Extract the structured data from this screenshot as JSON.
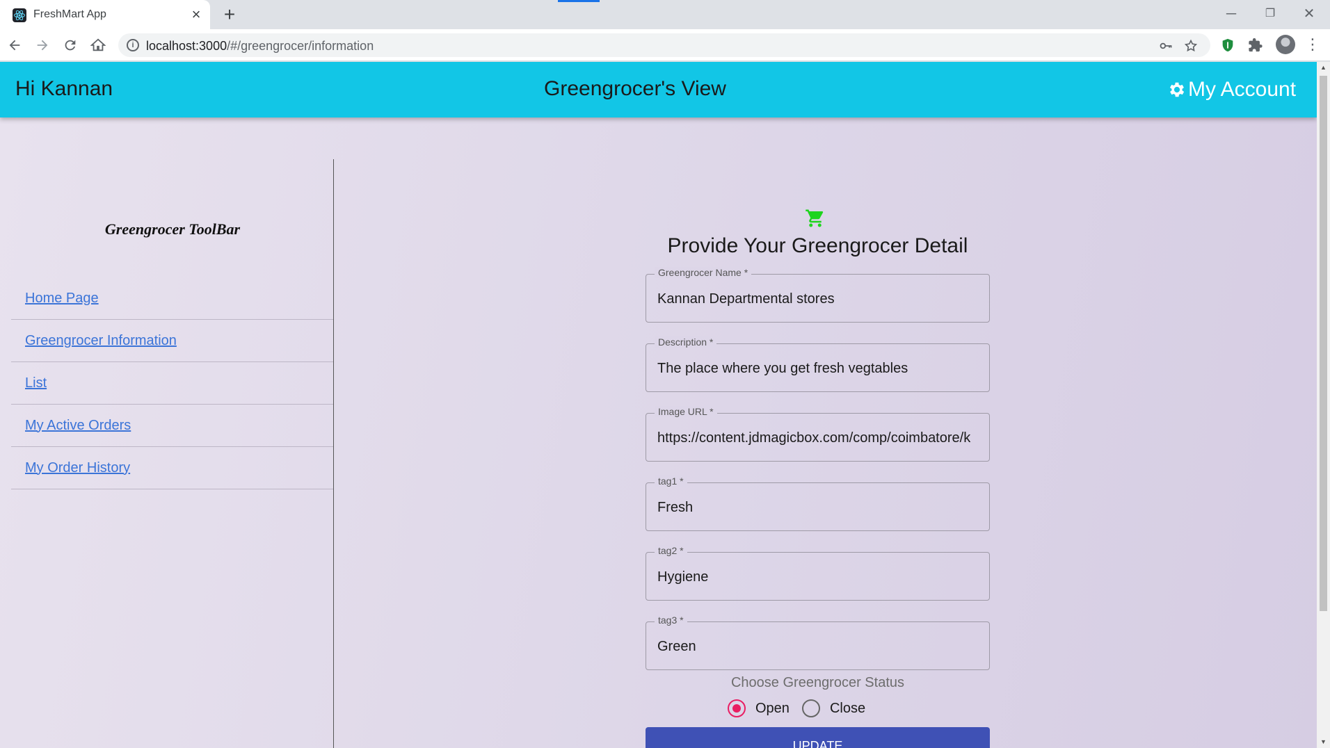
{
  "browser": {
    "tab_title": "FreshMart App",
    "url_host": "localhost:3000",
    "url_path": "/#/greengrocer/information"
  },
  "appbar": {
    "greeting": "Hi Kannan",
    "title": "Greengrocer's View",
    "account_label": "My Account",
    "color": "#12c6e6"
  },
  "sidebar": {
    "title": "Greengrocer ToolBar",
    "items": [
      {
        "label": "Home Page"
      },
      {
        "label": "Greengrocer Information"
      },
      {
        "label": "List"
      },
      {
        "label": "My Active Orders"
      },
      {
        "label": "My Order History"
      }
    ]
  },
  "form": {
    "icon": "shopping-cart-icon",
    "icon_color": "#1ed41e",
    "title": "Provide Your Greengrocer Detail",
    "fields": [
      {
        "label": "Greengrocer Name *",
        "value": "Kannan Departmental stores"
      },
      {
        "label": "Description *",
        "value": "The place where you get fresh vegtables"
      },
      {
        "label": "Image URL *",
        "value": "https://content.jdmagicbox.com/comp/coimbatore/k"
      },
      {
        "label": "tag1 *",
        "value": "Fresh"
      },
      {
        "label": "tag2 *",
        "value": "Hygiene"
      },
      {
        "label": "tag3 *",
        "value": "Green"
      }
    ],
    "status_label": "Choose Greengrocer Status",
    "status_options": [
      {
        "label": "Open",
        "selected": true
      },
      {
        "label": "Close",
        "selected": false
      }
    ],
    "submit_label": "UPDATE",
    "submit_color": "#3f51b5",
    "radio_color": "#e91e63"
  }
}
